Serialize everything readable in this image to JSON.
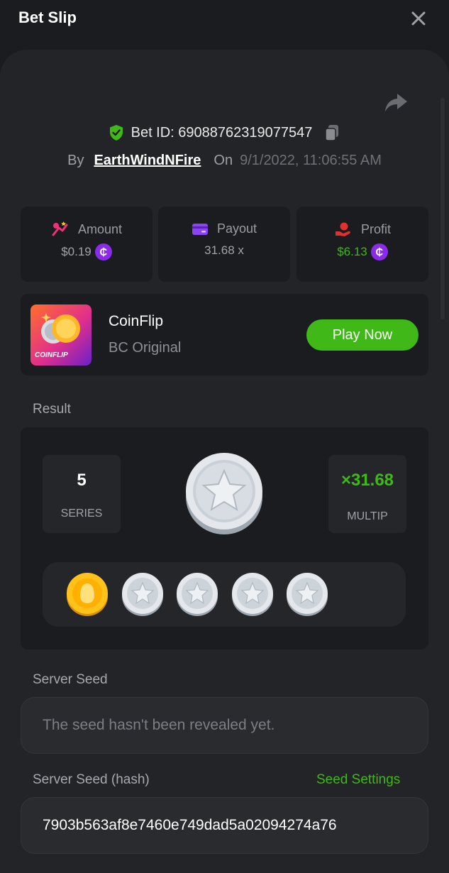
{
  "header": {
    "title": "Bet Slip"
  },
  "bet": {
    "id_label": "Bet ID: 69088762319077547",
    "by_label": "By",
    "username": "EarthWindNFire",
    "on_label": "On",
    "datetime": "9/1/2022, 11:06:55 AM"
  },
  "stats": {
    "amount": {
      "label": "Amount",
      "value": "$0.19"
    },
    "payout": {
      "label": "Payout",
      "value": "31.68 x"
    },
    "profit": {
      "label": "Profit",
      "value": "$6.13"
    }
  },
  "game": {
    "thumb_label": "COINFLIP",
    "name": "CoinFlip",
    "subtitle": "BC Original",
    "play_label": "Play Now"
  },
  "result": {
    "label": "Result",
    "series_value": "5",
    "series_caption": "SERIES",
    "multiplier_value": "×31.68",
    "multiplier_caption": "MULTIP",
    "history": [
      "gold",
      "silver",
      "silver",
      "silver",
      "silver"
    ]
  },
  "server_seed": {
    "label": "Server Seed",
    "value": "The seed hasn't been revealed yet."
  },
  "server_seed_hash": {
    "label": "Server Seed (hash)",
    "settings_label": "Seed Settings",
    "value": "7903b563af8e7460e749dad5a02094274a76"
  },
  "colors": {
    "accent_green": "#3fb818",
    "currency_purple": "#8b2bea",
    "background": "#1b1c1f",
    "panel": "#232427"
  }
}
